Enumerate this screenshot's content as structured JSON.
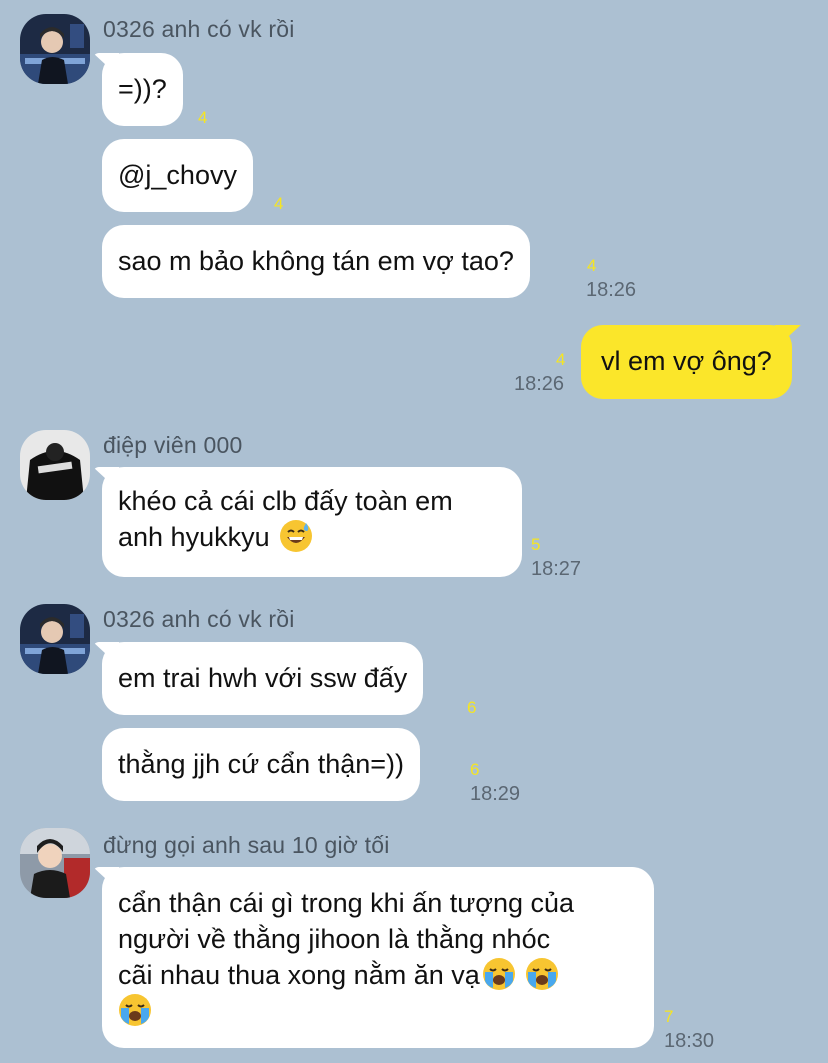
{
  "colors": {
    "background": "#acc0d2",
    "incoming_bubble": "#ffffff",
    "outgoing_bubble": "#fbe62a",
    "unread_count": "#f5e523"
  },
  "groups": [
    {
      "sender": "0326 anh có vk rồi",
      "avatar": "avatar-icon",
      "messages": [
        {
          "text": "=))?",
          "unread": "4",
          "time": ""
        },
        {
          "text": "@j_chovy",
          "unread": "4",
          "time": ""
        },
        {
          "text": "sao m bảo không tán em vợ tao?",
          "unread": "4",
          "time": "18:26"
        }
      ]
    },
    {
      "sender": "",
      "outgoing": true,
      "messages": [
        {
          "text": "vl em vợ ông?",
          "unread": "4",
          "time": "18:26"
        }
      ]
    },
    {
      "sender": "điệp viên 000",
      "avatar": "avatar-icon",
      "messages": [
        {
          "text_line1": "khéo cả cái clb đấy toàn em",
          "text_line2": "anh hyukkyu",
          "emoji": "sweat-smile-emoji-icon",
          "unread": "5",
          "time": "18:27"
        }
      ]
    },
    {
      "sender": "0326 anh có vk rồi",
      "avatar": "avatar-icon",
      "messages": [
        {
          "text": "em trai hwh với ssw đấy",
          "unread": "6",
          "time": ""
        },
        {
          "text": "thằng jjh cứ cẩn thận=))",
          "unread": "6",
          "time": "18:29"
        }
      ]
    },
    {
      "sender": "đừng gọi anh sau 10 giờ tối",
      "avatar": "avatar-icon",
      "messages": [
        {
          "line1": "cẩn thận cái gì trong khi ấn tượng của",
          "line2": "người về thằng jihoon là thằng nhóc",
          "line3": "cãi nhau thua xong nằm ăn vạ",
          "emoji": "loudly-crying-emoji-icon",
          "unread": "7",
          "time": "18:30"
        }
      ]
    }
  ]
}
